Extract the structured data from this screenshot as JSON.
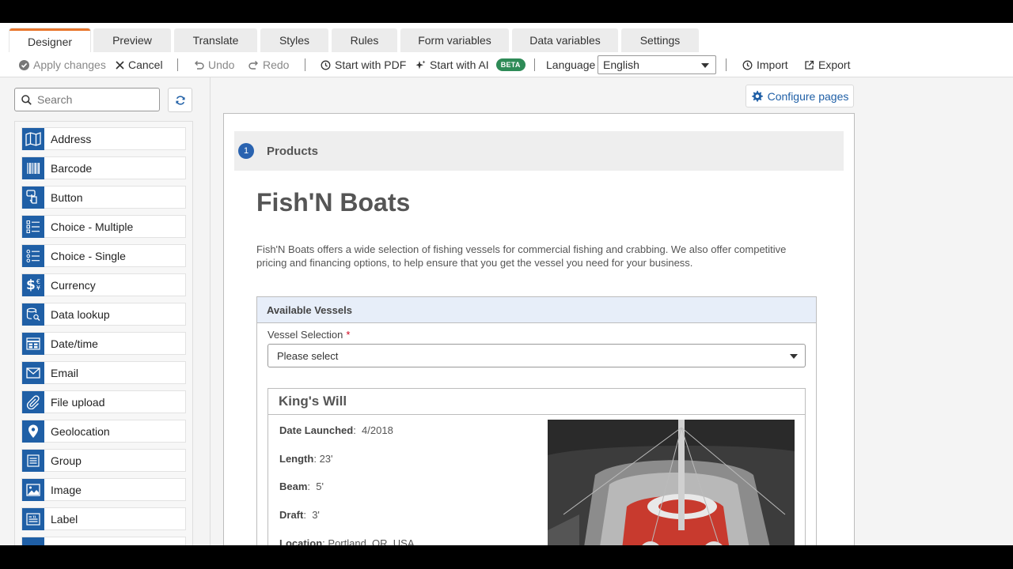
{
  "tabs": [
    {
      "label": "Designer",
      "active": true
    },
    {
      "label": "Preview"
    },
    {
      "label": "Translate"
    },
    {
      "label": "Styles"
    },
    {
      "label": "Rules"
    },
    {
      "label": "Form variables"
    },
    {
      "label": "Data variables"
    },
    {
      "label": "Settings"
    }
  ],
  "toolbar": {
    "apply": "Apply changes",
    "cancel": "Cancel",
    "undo": "Undo",
    "redo": "Redo",
    "start_pdf": "Start with PDF",
    "start_ai": "Start with AI",
    "beta": "BETA",
    "language_label": "Language",
    "language_value": "English",
    "import": "Import",
    "export": "Export"
  },
  "sidebar": {
    "search_placeholder": "Search",
    "items": [
      {
        "label": "Address",
        "icon": "map-icon"
      },
      {
        "label": "Barcode",
        "icon": "barcode-icon"
      },
      {
        "label": "Button",
        "icon": "pointer-icon"
      },
      {
        "label": "Choice - Multiple",
        "icon": "checklist-icon"
      },
      {
        "label": "Choice - Single",
        "icon": "radio-list-icon"
      },
      {
        "label": "Currency",
        "icon": "currency-icon"
      },
      {
        "label": "Data lookup",
        "icon": "database-search-icon"
      },
      {
        "label": "Date/time",
        "icon": "calendar-icon"
      },
      {
        "label": "Email",
        "icon": "envelope-icon"
      },
      {
        "label": "File upload",
        "icon": "paperclip-icon"
      },
      {
        "label": "Geolocation",
        "icon": "map-pin-icon"
      },
      {
        "label": "Group",
        "icon": "group-icon"
      },
      {
        "label": "Image",
        "icon": "image-icon"
      },
      {
        "label": "Label",
        "icon": "label-icon"
      }
    ]
  },
  "canvas": {
    "configure_pages": "Configure pages",
    "page_number": "1",
    "page_name": "Products",
    "title": "Fish'N Boats",
    "intro": "Fish'N Boats offers a wide selection of fishing vessels for commercial fishing and crabbing. We also offer competitive pricing and financing options, to help ensure that you get the vessel you need for your business.",
    "section_title": "Available Vessels",
    "vessel_label": "Vessel Selection",
    "required_mark": "*",
    "vessel_value": "Please select",
    "card": {
      "name": "King's Will",
      "specs": [
        {
          "label": "Date Launched",
          "value": "4/2018"
        },
        {
          "label": "Length",
          "value": "23'"
        },
        {
          "label": "Beam",
          "value": "5'"
        },
        {
          "label": "Draft",
          "value": "3'"
        },
        {
          "label": "Location",
          "value": "Portland, OR, USA"
        }
      ]
    }
  },
  "colors": {
    "accent": "#e8772e",
    "brand": "#1f5fa6",
    "beta": "#2e8b57"
  }
}
